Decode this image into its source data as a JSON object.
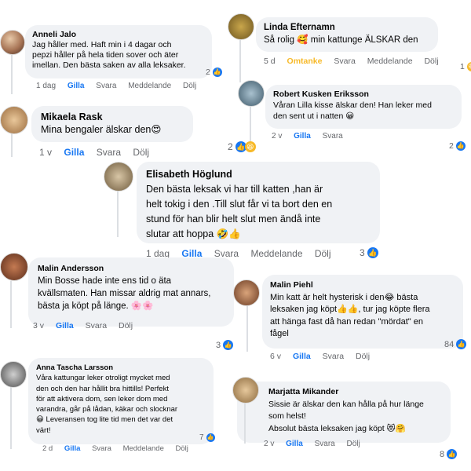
{
  "comments": [
    {
      "name": "Anneli Jalo",
      "text": "Jag håller med. Haft min i 4 dagar och\npepzi håller på hela tiden sover och äter\nimellan. Den bästa saken av alla leksaker.",
      "time": "1 dag",
      "like": "Gilla",
      "reply": "Svara",
      "message": "Meddelande",
      "hide": "Dölj",
      "count": "2"
    },
    {
      "name": "Linda Efternamn",
      "text": "Så rolig 🥰 min kattunge ÄLSKAR den",
      "time": "5 d",
      "like": "Omtanke",
      "reply": "Svara",
      "message": "Meddelande",
      "hide": "Dölj",
      "count": "1"
    },
    {
      "name": "Robert Kusken Eriksson",
      "text": "Våran Lilla kisse älskar den! Han leker med\nden sent ut i natten 😀",
      "time": "2 v",
      "like": "Gilla",
      "reply": "Svara",
      "count": "2"
    },
    {
      "name": "Mikaela Rask",
      "text": "Mina bengaler älskar den😍",
      "time": "1 v",
      "like": "Gilla",
      "reply": "Svara",
      "hide": "Dölj",
      "count": "2"
    },
    {
      "name": "Elisabeth Höglund",
      "text": "Den bästa leksak vi har  till katten ,han är\nhelt tokig i den .Till slut får vi ta bort  den en\nstund  för han blir  helt slut  men ändå inte\nslutar att  hoppa 🤣👍",
      "time": "1 dag",
      "like": "Gilla",
      "reply": "Svara",
      "message": "Meddelande",
      "hide": "Dölj",
      "count": "3"
    },
    {
      "name": "Malin Andersson",
      "text": "Min Bosse hade inte ens tid o äta\nkvällsmaten. Han missar aldrig mat annars,\nbästa ja köpt på länge. 🌸🌸",
      "time": "3 v",
      "like": "Gilla",
      "reply": "Svara",
      "hide": "Dölj",
      "count": "3"
    },
    {
      "name": "Malin Piehl",
      "text": "Min katt är helt hysterisk i den😂 bästa\nleksaken jag köpt👍👍, tur jag köpte flera\natt hänga fast då han redan \"mördat\" en\nfågel",
      "time": "6 v",
      "like": "Gilla",
      "reply": "Svara",
      "hide": "Dölj",
      "count": "84"
    },
    {
      "name": "Anna Tascha Larsson",
      "text": "Våra kattungar leker otroligt mycket med\nden och den har hållit bra hittills! Perfekt\nför att aktivera dom, sen leker dom med\nvarandra, går på lådan, käkar och slocknar\n😀 Leveransen tog lite tid men det var det\nvärt!",
      "time": "2 d",
      "like": "Gilla",
      "reply": "Svara",
      "message": "Meddelande",
      "hide": "Dölj",
      "count": "7"
    },
    {
      "name": "Marjatta Mikander",
      "text": "Sissie är älskar den kan hålla på hur länge\nsom helst!\nAbsolut bästa leksaken jag köpt 😻🤗",
      "time": "2 v",
      "like": "Gilla",
      "reply": "Svara",
      "hide": "Dölj",
      "count": "8"
    }
  ],
  "icons": {
    "like": "👍",
    "haha": "😆",
    "love": "🥰"
  },
  "colors": {
    "bubble": "#f0f2f5",
    "meta": "#65676b",
    "like_blue": "#1877f2",
    "care_yellow": "#f7b928"
  }
}
